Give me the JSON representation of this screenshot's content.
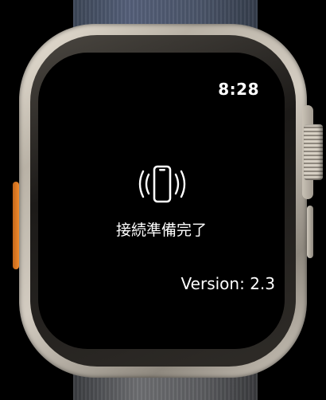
{
  "screen": {
    "time": "8:28",
    "status_icon": "phone-vibrate-icon",
    "status_text": "接続準備完了",
    "version_text": "Version: 2.3"
  },
  "colors": {
    "screen_background": "#000000",
    "text": "#ffffff",
    "action_button": "#f08a2c"
  }
}
